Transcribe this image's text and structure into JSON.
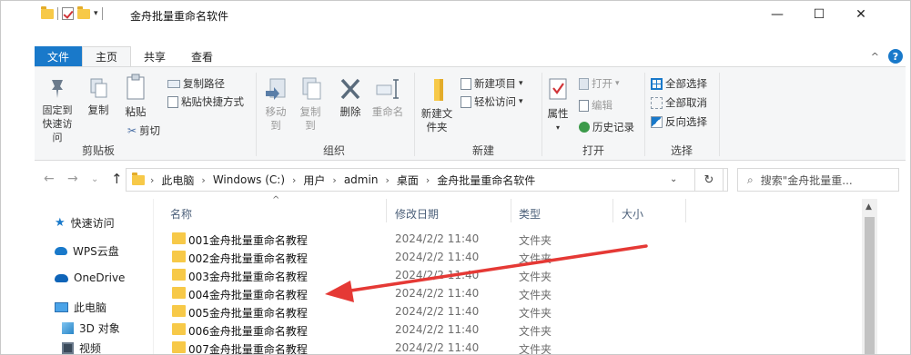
{
  "title_bar": {
    "title": "金舟批量重命名软件",
    "qa_sep": "|",
    "qa_dropdown": "▾",
    "minimize": "—",
    "maximize": "☐",
    "close": "✕"
  },
  "menu": {
    "tabs": [
      "文件",
      "主页",
      "共享",
      "查看"
    ],
    "active_tab": "主页",
    "collapse_caret": "^",
    "help": "?"
  },
  "ribbon": {
    "clipboard": {
      "pin_label": "固定到快速访问",
      "copy_label": "复制",
      "paste_label": "粘贴",
      "copy_path": "复制路径",
      "paste_shortcut": "粘贴快捷方式",
      "cut": "剪切",
      "group_label": "剪贴板"
    },
    "organize": {
      "move_to": "移动到",
      "copy_to": "复制到",
      "delete": "删除",
      "rename": "重命名",
      "group_label": "组织"
    },
    "new": {
      "new_folder": "新建文件夹",
      "new_item": "新建项目",
      "easy_access": "轻松访问",
      "group_label": "新建"
    },
    "open": {
      "properties": "属性",
      "open": "打开",
      "edit": "编辑",
      "history": "历史记录",
      "group_label": "打开"
    },
    "select": {
      "select_all": "全部选择",
      "select_none": "全部取消",
      "invert": "反向选择",
      "group_label": "选择"
    }
  },
  "address_bar": {
    "breadcrumbs": [
      "此电脑",
      "Windows (C:)",
      "用户",
      "admin",
      "桌面",
      "金舟批量重命名软件"
    ],
    "search_placeholder": "搜索\"金舟批量重...",
    "back": "←",
    "forward": "→",
    "recent": "⌄",
    "up": "↑",
    "crumb_sep": "›",
    "dropdown": "⌄",
    "refresh": "↻",
    "search_glyph": "⌕"
  },
  "nav_pane": {
    "items": [
      "快速访问",
      "WPS云盘",
      "OneDrive",
      "此电脑",
      "3D 对象",
      "视频"
    ]
  },
  "file_list": {
    "columns": [
      "名称",
      "修改日期",
      "类型",
      "大小"
    ],
    "sort_caret": "^",
    "scroll_up": "▲",
    "rows": [
      {
        "name": "001金舟批量重命名教程",
        "date": "2024/2/2 11:40",
        "type": "文件夹"
      },
      {
        "name": "002金舟批量重命名教程",
        "date": "2024/2/2 11:40",
        "type": "文件夹"
      },
      {
        "name": "003金舟批量重命名教程",
        "date": "2024/2/2 11:40",
        "type": "文件夹"
      },
      {
        "name": "004金舟批量重命名教程",
        "date": "2024/2/2 11:40",
        "type": "文件夹"
      },
      {
        "name": "005金舟批量重命名教程",
        "date": "2024/2/2 11:40",
        "type": "文件夹"
      },
      {
        "name": "006金舟批量重命名教程",
        "date": "2024/2/2 11:40",
        "type": "文件夹"
      },
      {
        "name": "007金舟批量重命名教程",
        "date": "2024/2/2 11:40",
        "type": "文件夹"
      }
    ]
  },
  "colors": {
    "accent": "#1979ca",
    "folder": "#f7c948",
    "annotation_arrow": "#e53935"
  }
}
